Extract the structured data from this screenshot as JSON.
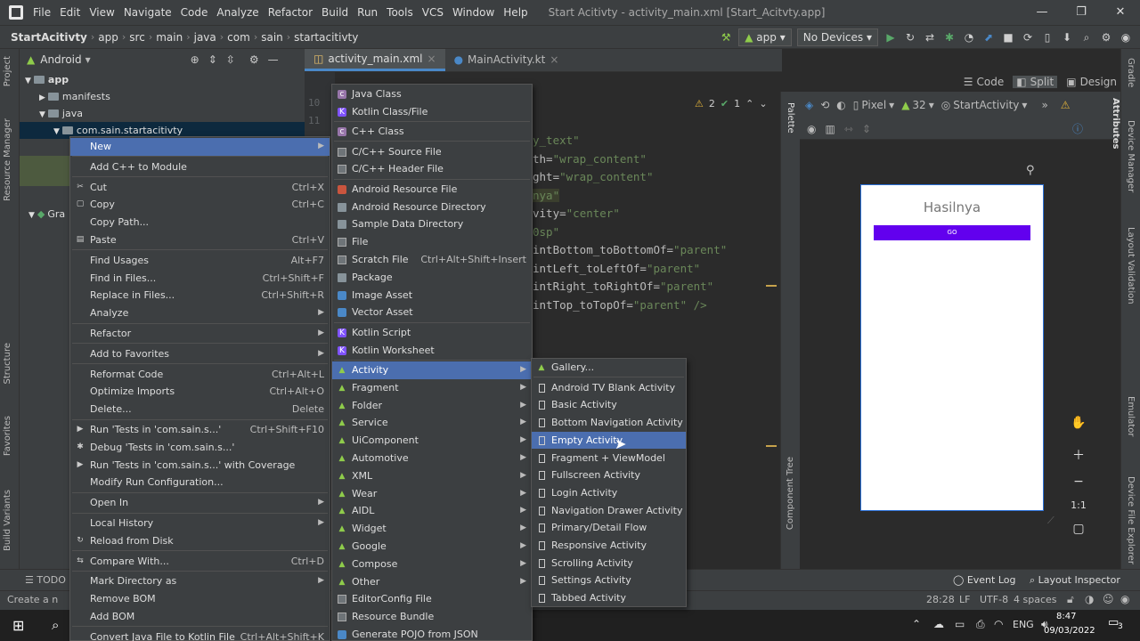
{
  "window": {
    "title": "Start Acitivty - activity_main.xml [Start_Acitvty.app]",
    "menus": [
      "File",
      "Edit",
      "View",
      "Navigate",
      "Code",
      "Analyze",
      "Refactor",
      "Build",
      "Run",
      "Tools",
      "VCS",
      "Window",
      "Help"
    ],
    "controls": [
      "—",
      "❐",
      "✕"
    ]
  },
  "breadcrumb": [
    "StartAcitivty",
    "app",
    "src",
    "main",
    "java",
    "com",
    "sain",
    "startacitivty"
  ],
  "toolbar": {
    "run_config": "app",
    "device": "No Devices"
  },
  "project": {
    "view": "Android",
    "tree": [
      {
        "label": "app",
        "bold": true
      },
      {
        "label": "manifests"
      },
      {
        "label": "java"
      },
      {
        "label": "com.sain.startacitivty"
      },
      {
        "label": "Gra"
      }
    ]
  },
  "tabs": [
    {
      "label": "activity_main.xml",
      "active": true
    },
    {
      "label": "MainActivity.kt",
      "active": false
    }
  ],
  "editor": {
    "line_numbers": [
      "10",
      "11"
    ],
    "warnings": "2",
    "checks": "1",
    "lines": [
      {
        "a": "",
        "s": "y_text\""
      },
      {
        "a": "th=",
        "s": "\"wrap_content\""
      },
      {
        "a": "ght=",
        "s": "\"wrap_content\""
      },
      {
        "a": "",
        "s": "nya\""
      },
      {
        "a": "vity=",
        "s": "\"center\""
      },
      {
        "a": "",
        "s": "0sp\""
      },
      {
        "a": "intBottom_toBottomOf=",
        "s": "\"parent\""
      },
      {
        "a": "intLeft_toLeftOf=",
        "s": "\"parent\""
      },
      {
        "a": "intRight_toRightOf=",
        "s": "\"parent\""
      },
      {
        "a": "intTop_toTopOf=",
        "s": "\"parent\" />"
      }
    ]
  },
  "view_modes": [
    "Code",
    "Split",
    "Design"
  ],
  "design": {
    "device": "Pixel",
    "api": "32",
    "theme": "StartActivity",
    "preview_text": "Hasilnya",
    "preview_button": "GO"
  },
  "left_strip": [
    "Project",
    "Resource Manager",
    "Structure",
    "Favorites",
    "Build Variants"
  ],
  "right_strip": [
    "Gradle",
    "Device Manager",
    "Layout Validation",
    "Emulator",
    "Device File Explorer"
  ],
  "palette_tabs": [
    "Palette",
    "Component Tree",
    "Attributes"
  ],
  "context_menu": [
    {
      "label": "New",
      "arrow": true,
      "hl": true
    },
    {
      "sep": true
    },
    {
      "label": "Add C++ to Module"
    },
    {
      "sep": true
    },
    {
      "label": "Cut",
      "shortcut": "Ctrl+X",
      "icon": "✂"
    },
    {
      "label": "Copy",
      "shortcut": "Ctrl+C",
      "icon": "▢"
    },
    {
      "label": "Copy Path..."
    },
    {
      "label": "Paste",
      "shortcut": "Ctrl+V",
      "icon": "▤"
    },
    {
      "sep": true
    },
    {
      "label": "Find Usages",
      "shortcut": "Alt+F7"
    },
    {
      "label": "Find in Files...",
      "shortcut": "Ctrl+Shift+F"
    },
    {
      "label": "Replace in Files...",
      "shortcut": "Ctrl+Shift+R"
    },
    {
      "label": "Analyze",
      "arrow": true
    },
    {
      "sep": true
    },
    {
      "label": "Refactor",
      "arrow": true
    },
    {
      "sep": true
    },
    {
      "label": "Add to Favorites",
      "arrow": true
    },
    {
      "sep": true
    },
    {
      "label": "Reformat Code",
      "shortcut": "Ctrl+Alt+L"
    },
    {
      "label": "Optimize Imports",
      "shortcut": "Ctrl+Alt+O"
    },
    {
      "label": "Delete...",
      "shortcut": "Delete"
    },
    {
      "sep": true
    },
    {
      "label": "Run 'Tests in 'com.sain.s...'",
      "shortcut": "Ctrl+Shift+F10",
      "icon": "▶"
    },
    {
      "label": "Debug 'Tests in 'com.sain.s...'",
      "icon": "✱"
    },
    {
      "label": "Run 'Tests in 'com.sain.s...' with Coverage",
      "icon": "▶"
    },
    {
      "label": "Modify Run Configuration..."
    },
    {
      "sep": true
    },
    {
      "label": "Open In",
      "arrow": true
    },
    {
      "sep": true
    },
    {
      "label": "Local History",
      "arrow": true
    },
    {
      "label": "Reload from Disk",
      "icon": "↻"
    },
    {
      "sep": true
    },
    {
      "label": "Compare With...",
      "shortcut": "Ctrl+D",
      "icon": "⇆"
    },
    {
      "sep": true
    },
    {
      "label": "Mark Directory as",
      "arrow": true
    },
    {
      "label": "Remove BOM"
    },
    {
      "label": "Add BOM"
    },
    {
      "sep": true
    },
    {
      "label": "Convert Java File to Kotlin File",
      "shortcut": "Ctrl+Alt+Shift+K"
    }
  ],
  "new_menu": [
    {
      "label": "Java Class",
      "icon": "c"
    },
    {
      "label": "Kotlin Class/File",
      "icon": "k"
    },
    {
      "sep": true
    },
    {
      "label": "C++ Class",
      "icon": "c"
    },
    {
      "sep": true
    },
    {
      "label": "C/C++ Source File",
      "icon": "f"
    },
    {
      "label": "C/C++ Header File",
      "icon": "f"
    },
    {
      "sep": true
    },
    {
      "label": "Android Resource File",
      "icon": "r"
    },
    {
      "label": "Android Resource Directory",
      "icon": "d"
    },
    {
      "label": "Sample Data Directory",
      "icon": "d"
    },
    {
      "label": "File",
      "icon": "f"
    },
    {
      "label": "Scratch File",
      "shortcut": "Ctrl+Alt+Shift+Insert",
      "icon": "f"
    },
    {
      "label": "Package",
      "icon": "d"
    },
    {
      "label": "Image Asset",
      "icon": "b"
    },
    {
      "label": "Vector Asset",
      "icon": "b"
    },
    {
      "sep": true
    },
    {
      "label": "Kotlin Script",
      "icon": "k"
    },
    {
      "label": "Kotlin Worksheet",
      "icon": "k"
    },
    {
      "sep": true
    },
    {
      "label": "Activity",
      "arrow": true,
      "hl": true,
      "icon": "a"
    },
    {
      "label": "Fragment",
      "arrow": true,
      "icon": "a"
    },
    {
      "label": "Folder",
      "arrow": true,
      "icon": "a"
    },
    {
      "label": "Service",
      "arrow": true,
      "icon": "a"
    },
    {
      "label": "UiComponent",
      "arrow": true,
      "icon": "a"
    },
    {
      "label": "Automotive",
      "arrow": true,
      "icon": "a"
    },
    {
      "label": "XML",
      "arrow": true,
      "icon": "a"
    },
    {
      "label": "Wear",
      "arrow": true,
      "icon": "a"
    },
    {
      "label": "AIDL",
      "arrow": true,
      "icon": "a"
    },
    {
      "label": "Widget",
      "arrow": true,
      "icon": "a"
    },
    {
      "label": "Google",
      "arrow": true,
      "icon": "a"
    },
    {
      "label": "Compose",
      "arrow": true,
      "icon": "a"
    },
    {
      "label": "Other",
      "arrow": true,
      "icon": "a"
    },
    {
      "label": "EditorConfig File",
      "icon": "f"
    },
    {
      "label": "Resource Bundle",
      "icon": "f"
    },
    {
      "label": "Generate POJO from JSON",
      "icon": "b"
    }
  ],
  "activity_menu": [
    {
      "label": "Gallery...",
      "icon": "a"
    },
    {
      "sep": true
    },
    {
      "label": "Android TV Blank Activity",
      "icon": "p"
    },
    {
      "label": "Basic Activity",
      "icon": "p"
    },
    {
      "label": "Bottom Navigation Activity",
      "icon": "p"
    },
    {
      "label": "Empty Activity",
      "icon": "p",
      "hl": true
    },
    {
      "label": "Fragment + ViewModel",
      "icon": "p"
    },
    {
      "label": "Fullscreen Activity",
      "icon": "p"
    },
    {
      "label": "Login Activity",
      "icon": "p"
    },
    {
      "label": "Navigation Drawer Activity",
      "icon": "p"
    },
    {
      "label": "Primary/Detail Flow",
      "icon": "p"
    },
    {
      "label": "Responsive Activity",
      "icon": "p"
    },
    {
      "label": "Scrolling Activity",
      "icon": "p"
    },
    {
      "label": "Settings Activity",
      "icon": "p"
    },
    {
      "label": "Tabbed Activity",
      "icon": "p"
    }
  ],
  "bottom_tools": {
    "left": "TODO",
    "event_log": "Event Log",
    "layout_inspector": "Layout Inspector"
  },
  "status": {
    "message": "Create a n",
    "position": "28:28",
    "line_sep": "LF",
    "encoding": "UTF-8",
    "indent": "4 spaces"
  },
  "taskbar": {
    "lang": "ENG",
    "time": "8:47",
    "date": "09/03/2022",
    "notif": "3"
  }
}
